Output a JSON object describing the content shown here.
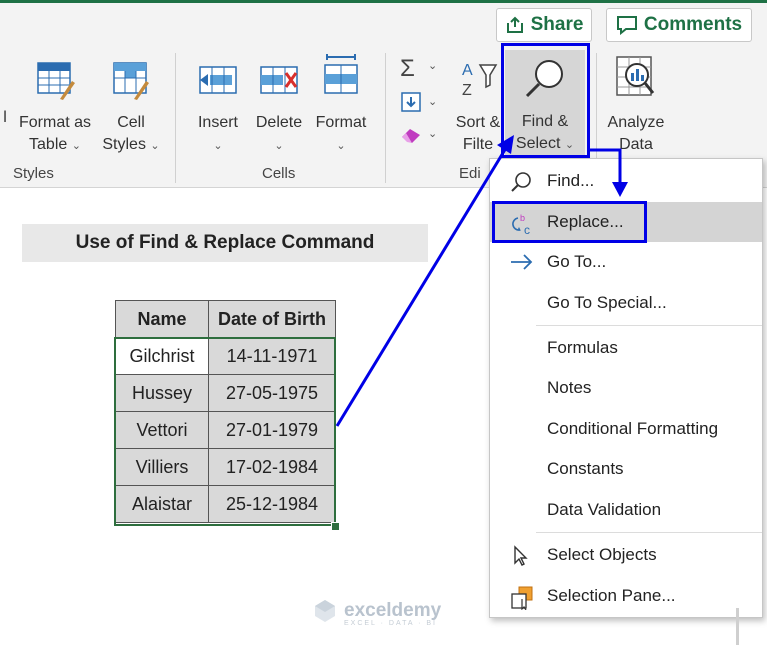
{
  "header": {
    "share_label": "Share",
    "comments_label": "Comments"
  },
  "ribbon": {
    "styles_partial_label": "l",
    "format_as_table_line1": "Format as",
    "format_as_table_line2": "Table",
    "cell_styles_line1": "Cell",
    "cell_styles_line2": "Styles",
    "styles_group_label": "Styles",
    "insert_label": "Insert",
    "delete_label": "Delete",
    "format_label": "Format",
    "cells_group_label": "Cells",
    "sort_filter_line1": "Sort &",
    "sort_filter_line2": "Filte",
    "find_select_line1": "Find &",
    "find_select_line2": "Select",
    "analyze_data_line1": "Analyze",
    "analyze_data_line2": "Data",
    "editing_group_label_partial": "Edi",
    "caret": "⌄"
  },
  "sheet": {
    "title": "Use of Find & Replace Command",
    "table": {
      "headers": [
        "Name",
        "Date of Birth"
      ],
      "rows": [
        {
          "name": "Gilchrist",
          "dob": "14-11-1971"
        },
        {
          "name": "Hussey",
          "dob": "27-05-1975"
        },
        {
          "name": "Vettori",
          "dob": "27-01-1979"
        },
        {
          "name": "Villiers",
          "dob": "17-02-1984"
        },
        {
          "name": "Alaistar",
          "dob": "25-12-1984"
        }
      ]
    }
  },
  "menu": {
    "find": "Find...",
    "replace": "Replace...",
    "go_to": "Go To...",
    "go_to_special": "Go To Special...",
    "formulas": "Formulas",
    "notes": "Notes",
    "conditional_formatting": "Conditional Formatting",
    "constants": "Constants",
    "data_validation": "Data Validation",
    "select_objects": "Select Objects",
    "selection_pane": "Selection Pane..."
  },
  "watermark": {
    "brand": "exceldemy",
    "tagline": "EXCEL · DATA · BI"
  },
  "colors": {
    "excel_green": "#1e7145",
    "annotation_blue": "#0000e6",
    "menu_highlight": "#d4d4d4",
    "table_fill": "#d9d9d9"
  }
}
